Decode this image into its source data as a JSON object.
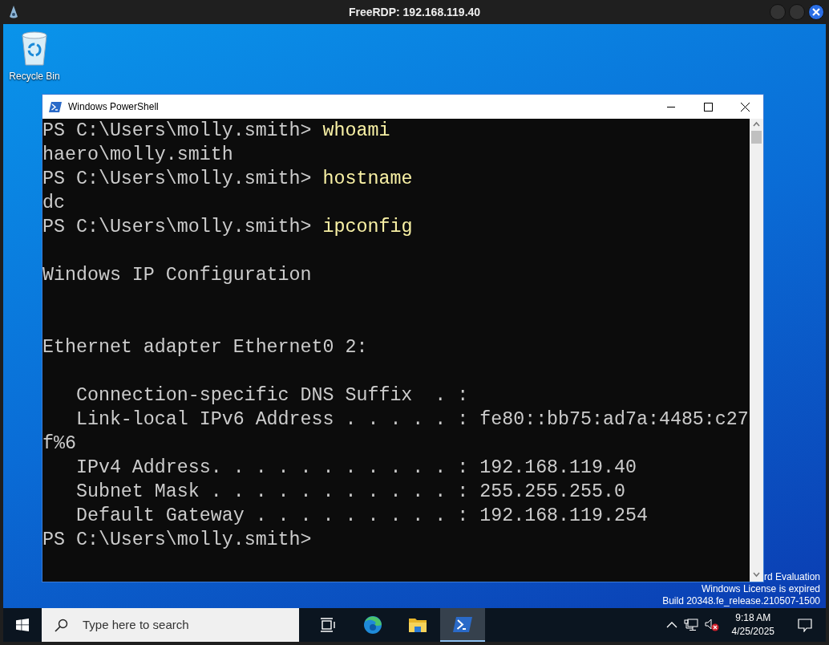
{
  "rdp_window": {
    "title": "FreeRDP: 192.168.119.40"
  },
  "desktop_icons": [
    {
      "label": "Recycle Bin"
    }
  ],
  "powershell": {
    "title": "Windows PowerShell",
    "lines": [
      {
        "kind": "prompt",
        "prompt": "PS C:\\Users\\molly.smith>",
        "command": "whoami"
      },
      {
        "kind": "output",
        "text": "haero\\molly.smith"
      },
      {
        "kind": "prompt",
        "prompt": "PS C:\\Users\\molly.smith>",
        "command": "hostname"
      },
      {
        "kind": "output",
        "text": "dc"
      },
      {
        "kind": "prompt",
        "prompt": "PS C:\\Users\\molly.smith>",
        "command": "ipconfig"
      },
      {
        "kind": "blank"
      },
      {
        "kind": "output",
        "text": "Windows IP Configuration"
      },
      {
        "kind": "blank"
      },
      {
        "kind": "blank"
      },
      {
        "kind": "output",
        "text": "Ethernet adapter Ethernet0 2:"
      },
      {
        "kind": "blank"
      },
      {
        "kind": "output",
        "text": "   Connection-specific DNS Suffix  . :"
      },
      {
        "kind": "output",
        "text": "   Link-local IPv6 Address . . . . . : fe80::bb75:ad7a:4485:c27"
      },
      {
        "kind": "output",
        "text": "f%6"
      },
      {
        "kind": "output",
        "text": "   IPv4 Address. . . . . . . . . . . : 192.168.119.40"
      },
      {
        "kind": "output",
        "text": "   Subnet Mask . . . . . . . . . . . : 255.255.255.0"
      },
      {
        "kind": "output",
        "text": "   Default Gateway . . . . . . . . . : 192.168.119.254"
      },
      {
        "kind": "prompt",
        "prompt": "PS C:\\Users\\molly.smith>"
      }
    ]
  },
  "watermark": [
    "rd Evaluation",
    "Windows License is expired",
    "Build 20348.fe_release.210507-1500"
  ],
  "taskbar": {
    "search": {
      "placeholder": "Type here to search"
    },
    "apps": [
      {
        "kind": "taskview",
        "selected": false
      },
      {
        "kind": "edge",
        "selected": false
      },
      {
        "kind": "explorer",
        "selected": false
      },
      {
        "kind": "powershell",
        "selected": true
      }
    ],
    "time": "9:18 AM",
    "date": "4/25/2025"
  }
}
